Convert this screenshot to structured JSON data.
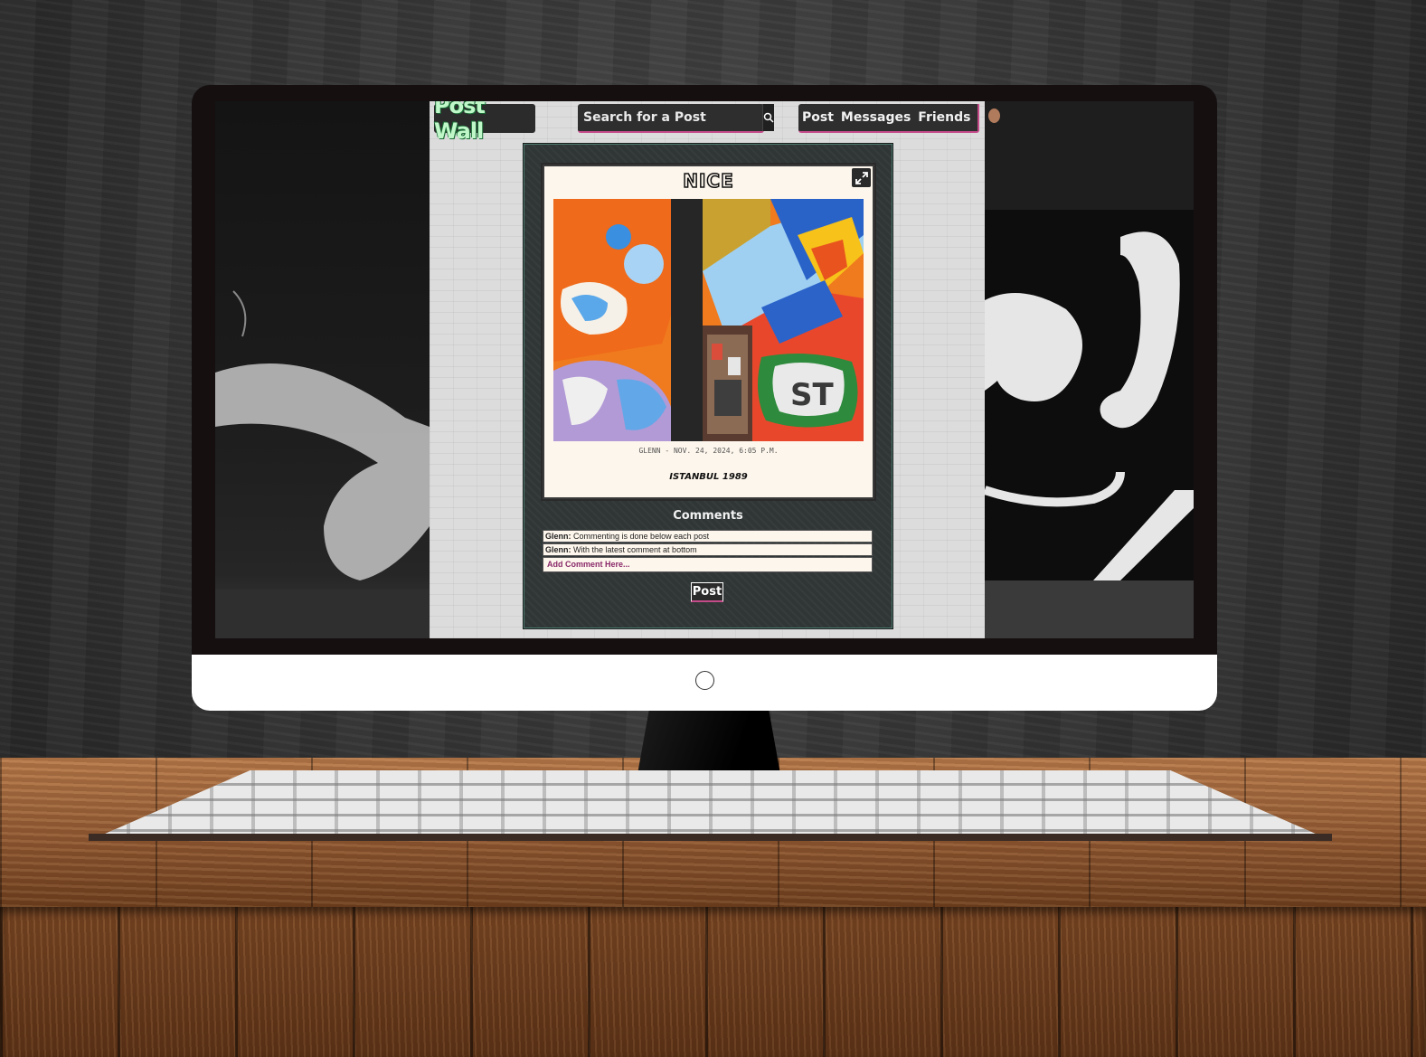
{
  "app": {
    "logo": "Post Wall",
    "search": {
      "placeholder": "Search for a Post"
    },
    "nav": {
      "post": "Post",
      "messages": "Messages",
      "friends": "Friends"
    }
  },
  "post": {
    "title": "NICE",
    "meta": "GLENN - NOV. 24, 2024, 6:05 P.M.",
    "caption": "ISTANBUL 1989"
  },
  "comments": {
    "title": "Comments",
    "items": [
      {
        "author": "Glenn:",
        "text": "Commenting is done below each post"
      },
      {
        "author": "Glenn:",
        "text": "With the latest comment at bottom"
      }
    ],
    "add_placeholder": "Add Comment Here..."
  },
  "post_button": "Post",
  "colors": {
    "accent": "#c44a8a",
    "logo_text": "#bff7c9",
    "card_bg": "#fdf6ec"
  },
  "icons": {
    "search": "search-icon",
    "expand": "expand-icon",
    "avatar": "avatar"
  }
}
